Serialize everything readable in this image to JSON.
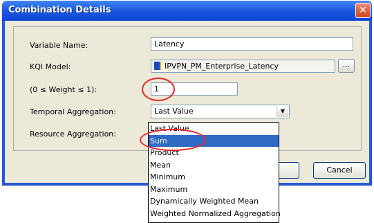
{
  "window": {
    "title": "Combination Details",
    "close_symbol": "✕"
  },
  "form": {
    "variable_name_label": "Variable Name:",
    "variable_name_value": "Latency",
    "kqi_model_label": "KQI Model:",
    "kqi_model_value": "IPVPN_PM_Enterprise_Latency",
    "kqi_browse_label": "...",
    "weight_label": "(0 ≤ Weight ≤ 1):",
    "weight_value": "1",
    "temporal_label": "Temporal Aggregation:",
    "temporal_value": "Last Value",
    "resource_label": "Resource Aggregation:"
  },
  "dropdown": {
    "options": [
      "Last Value",
      "Sum",
      "Product",
      "Mean",
      "Minimum",
      "Maximum",
      "Dynamically Weighted Mean",
      "Weighted Normalized Aggregation"
    ],
    "highlighted": "Sum"
  },
  "buttons": {
    "cancel": "Cancel"
  },
  "colors": {
    "annotation": "#e22222",
    "highlight": "#316ac5",
    "title_bar": "#0a46d6"
  },
  "icons": {
    "kqi": "kqi-model-icon",
    "dropdown_arrow": "▼"
  }
}
